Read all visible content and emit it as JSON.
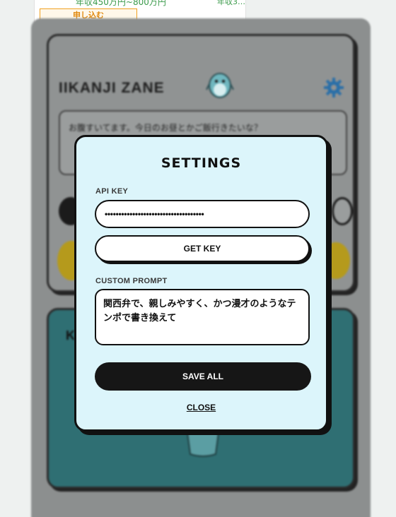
{
  "background": {
    "salary_text": "年収450万円~800万円",
    "salary_text_right": "年収3…",
    "apply_label": "申し込む",
    "app_title": "IIKANJI ZANE",
    "chat_text": "お腹すいてます。今日のお昼とかご飯行きたいな？",
    "teal_card_letter": "K"
  },
  "modal": {
    "title": "SETTINGS",
    "api_key_label": "API KEY",
    "api_key_value": "••••••••••••••••••••••••••••••••••••",
    "get_key_label": "GET KEY",
    "custom_prompt_label": "CUSTOM PROMPT",
    "custom_prompt_value": "関西弁で、親しみやすく、かつ漫才のようなテンポで書き換えて",
    "save_all_label": "SAVE ALL",
    "close_label": "CLOSE"
  },
  "colors": {
    "modal_bg": "#dcf5fb",
    "accent_dark": "#161616",
    "gear_blue": "#2a6fa8",
    "teal_card": "#2f6f73"
  },
  "icons": {
    "gear": "gear-icon",
    "mascot": "mascot-icon"
  }
}
